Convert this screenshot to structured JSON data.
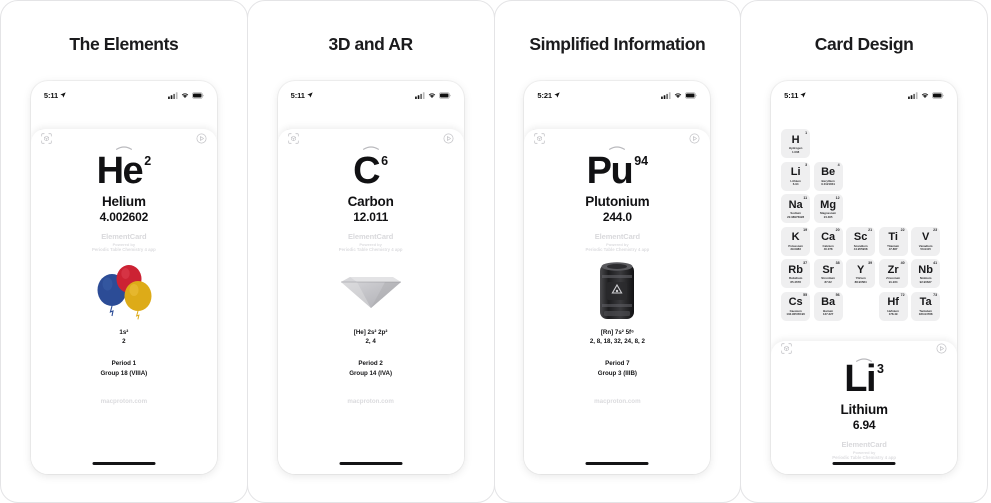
{
  "panels": [
    {
      "title": "The Elements",
      "status": {
        "time": "5:11",
        "location_icon": "location-arrow-icon",
        "signal_icon": "cellular-bars-icon",
        "wifi_icon": "wifi-icon",
        "battery_icon": "battery-full-icon"
      },
      "card_mode": "full",
      "toolbar": {
        "left_icon": "ar-scan-icon",
        "handle_icon": "chevron-up-handle-icon",
        "right_icon": "rotate-play-icon"
      },
      "element": {
        "symbol": "He",
        "atomic_number": "2",
        "name": "Helium",
        "mass": "4.002602",
        "model_icon": "balloons-image",
        "config": "1s²",
        "shells": "2",
        "period": "Period  1",
        "group": "Group  18 (VIIIA)"
      },
      "brand": {
        "title": "ElementCard",
        "powered": "Powered by",
        "app": "Periodic Table Chemistry 4 app"
      },
      "site": "macproton.com"
    },
    {
      "title": "3D and AR",
      "status": {
        "time": "5:11",
        "location_icon": "location-arrow-icon",
        "signal_icon": "cellular-bars-icon",
        "wifi_icon": "wifi-icon",
        "battery_icon": "battery-full-icon"
      },
      "card_mode": "full",
      "toolbar": {
        "left_icon": "ar-scan-icon",
        "handle_icon": "chevron-up-handle-icon",
        "right_icon": "rotate-play-icon"
      },
      "element": {
        "symbol": "C",
        "atomic_number": "6",
        "name": "Carbon",
        "mass": "12.011",
        "model_icon": "diamond-image",
        "config": "[He] 2s² 2p²",
        "shells": "2, 4",
        "period": "Period  2",
        "group": "Group  14 (IVA)"
      },
      "brand": {
        "title": "ElementCard",
        "powered": "Powered by",
        "app": "Periodic Table Chemistry 4 app"
      },
      "site": "macproton.com"
    },
    {
      "title": "Simplified Information",
      "status": {
        "time": "5:21",
        "location_icon": "location-arrow-icon",
        "signal_icon": "cellular-bars-icon",
        "wifi_icon": "wifi-icon",
        "battery_icon": "battery-full-icon"
      },
      "card_mode": "full",
      "toolbar": {
        "left_icon": "ar-scan-icon",
        "handle_icon": "chevron-up-handle-icon",
        "right_icon": "rotate-play-icon"
      },
      "element": {
        "symbol": "Pu",
        "atomic_number": "94",
        "name": "Plutonium",
        "mass": "244.0",
        "model_icon": "nuclear-cask-image",
        "config": "[Rn] 7s² 5f⁶",
        "shells": "2, 8, 18, 32, 24, 8, 2",
        "period": "Period  7",
        "group": "Group  3 (IIIB)"
      },
      "brand": {
        "title": "ElementCard",
        "powered": "Powered by",
        "app": "Periodic Table Chemistry 4 app"
      },
      "site": "macproton.com"
    },
    {
      "title": "Card Design",
      "status": {
        "time": "5:11",
        "location_icon": "location-arrow-icon",
        "signal_icon": "cellular-bars-icon",
        "wifi_icon": "wifi-icon",
        "battery_icon": "battery-full-icon"
      },
      "card_mode": "partial",
      "toolbar": {
        "left_icon": "ar-scan-icon",
        "handle_icon": "chevron-up-handle-icon",
        "right_icon": "rotate-play-icon"
      },
      "element": {
        "symbol": "Li",
        "atomic_number": "3",
        "name": "Lithium",
        "mass": "6.94",
        "model_icon": "lithium-metal-image"
      },
      "brand": {
        "title": "ElementCard",
        "powered": "Powered by",
        "app": "Periodic Table Chemistry 4 app"
      },
      "periodic_table": [
        [
          {
            "symbol": "H",
            "number": "1",
            "name": "Hydrogen",
            "mass": "1.008"
          },
          null,
          null,
          null,
          null
        ],
        [
          {
            "symbol": "Li",
            "number": "3",
            "name": "Lithium",
            "mass": "6.94"
          },
          {
            "symbol": "Be",
            "number": "4",
            "name": "Beryllium",
            "mass": "9.0121831"
          },
          null,
          null,
          null
        ],
        [
          {
            "symbol": "Na",
            "number": "11",
            "name": "Sodium",
            "mass": "22.98976928"
          },
          {
            "symbol": "Mg",
            "number": "12",
            "name": "Magnesium",
            "mass": "24.305"
          },
          null,
          null,
          null
        ],
        [
          {
            "symbol": "K",
            "number": "19",
            "name": "Potassium",
            "mass": "39.0983"
          },
          {
            "symbol": "Ca",
            "number": "20",
            "name": "Calcium",
            "mass": "40.078"
          },
          {
            "symbol": "Sc",
            "number": "21",
            "name": "Scandium",
            "mass": "44.955908"
          },
          {
            "symbol": "Ti",
            "number": "22",
            "name": "Titanium",
            "mass": "47.867"
          },
          {
            "symbol": "V",
            "number": "23",
            "name": "Vanadium",
            "mass": "50.9415"
          }
        ],
        [
          {
            "symbol": "Rb",
            "number": "37",
            "name": "Rubidium",
            "mass": "85.4678"
          },
          {
            "symbol": "Sr",
            "number": "38",
            "name": "Strontium",
            "mass": "87.62"
          },
          {
            "symbol": "Y",
            "number": "39",
            "name": "Yttrium",
            "mass": "88.90584"
          },
          {
            "symbol": "Zr",
            "number": "40",
            "name": "Zirconium",
            "mass": "91.224"
          },
          {
            "symbol": "Nb",
            "number": "41",
            "name": "Niobium",
            "mass": "92.90637"
          }
        ],
        [
          {
            "symbol": "Cs",
            "number": "55",
            "name": "Caesium",
            "mass": "132.90545196"
          },
          {
            "symbol": "Ba",
            "number": "56",
            "name": "Barium",
            "mass": "137.327"
          },
          null,
          {
            "symbol": "Hf",
            "number": "72",
            "name": "Hafnium",
            "mass": "178.49"
          },
          {
            "symbol": "Ta",
            "number": "73",
            "name": "Tantalum",
            "mass": "180.94788"
          }
        ]
      ]
    }
  ],
  "colors": {
    "background": "#ffffff",
    "panel_border": "#e4e4e6",
    "text": "#111113",
    "muted": "#dcdcdf",
    "tile_bg": "#efeff0",
    "home_indicator": "#141416"
  }
}
